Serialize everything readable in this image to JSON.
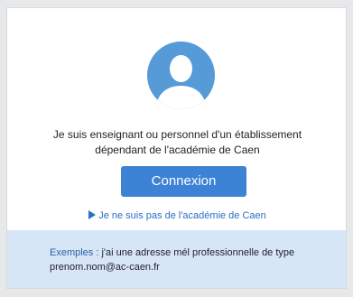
{
  "description": {
    "line1": "Je suis enseignant ou personnel d'un établissement",
    "line2": "dépendant de l'académie de Caen"
  },
  "login_button": "Connexion",
  "alt_link": "Je ne suis pas de l'académie de Caen",
  "info": {
    "label": "Exemples :",
    "line1_rest": " j'ai une adresse mél professionnelle de type",
    "line2": "prenom.nom@ac-caen.fr"
  },
  "colors": {
    "accent": "#3c83d6",
    "avatar": "#569ad8",
    "info_bg": "#d7e6f7",
    "link": "#2a6fc9"
  },
  "icons": [
    "user-avatar-icon",
    "play-triangle-icon"
  ]
}
